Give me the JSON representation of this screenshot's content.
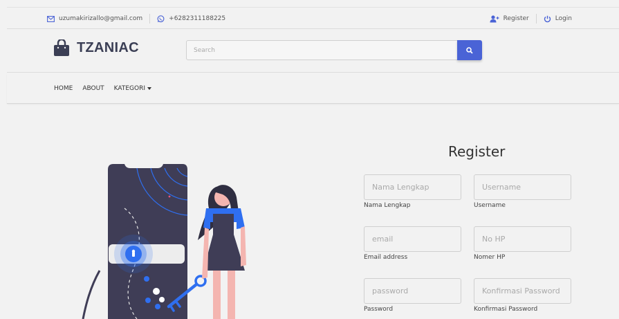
{
  "topbar": {
    "email": "uzumakirizallo@gmail.com",
    "phone": "+6282311188225",
    "register_label": "Register",
    "login_label": "Login"
  },
  "header": {
    "brand": "TZANIAC",
    "search_placeholder": "Search"
  },
  "nav": {
    "items": [
      "HOME",
      "ABOUT",
      "KATEGORI"
    ]
  },
  "form": {
    "title": "Register",
    "fields": [
      {
        "placeholder": "Nama Lengkap",
        "label": "Nama Lengkap"
      },
      {
        "placeholder": "Username",
        "label": "Username"
      },
      {
        "placeholder": "email",
        "label": "Email address"
      },
      {
        "placeholder": "No HP",
        "label": "Nomer HP"
      },
      {
        "placeholder": "password",
        "label": "Password"
      },
      {
        "placeholder": "Konfirmasi Password",
        "label": "Konfirmasi Password"
      }
    ]
  },
  "colors": {
    "accent": "#4a63d6",
    "brand_text": "#3b3f55",
    "illustration_dark": "#3f3d56",
    "illustration_blue": "#2f6ff0"
  }
}
